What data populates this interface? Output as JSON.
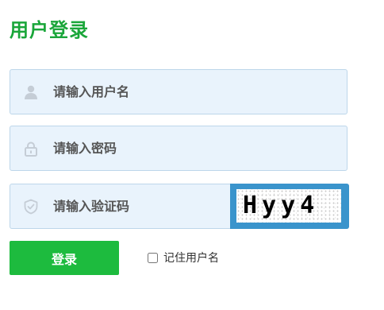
{
  "title": "用户登录",
  "username": {
    "placeholder": "请输入用户名",
    "value": "",
    "icon": "user-icon"
  },
  "password": {
    "placeholder": "请输入密码",
    "value": "",
    "icon": "lock-icon"
  },
  "captcha": {
    "placeholder": "请输入验证码",
    "value": "",
    "icon": "shield-icon",
    "image_text": "Hyy4"
  },
  "login_button": "登录",
  "remember": {
    "label": "记住用户名",
    "checked": false
  },
  "colors": {
    "title": "#1aa63a",
    "button": "#1dbb3e",
    "field_bg": "#e9f3fc",
    "captcha_frame": "#3a94cc"
  }
}
